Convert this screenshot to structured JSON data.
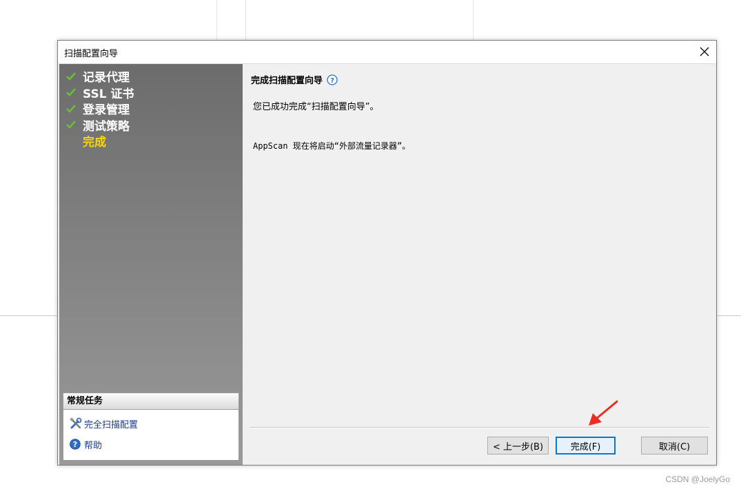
{
  "dialog": {
    "title": "扫描配置向导",
    "close_icon": "close-icon"
  },
  "steps": [
    {
      "label": "记录代理",
      "done": true
    },
    {
      "label": "SSL 证书",
      "done": true
    },
    {
      "label": "登录管理",
      "done": true
    },
    {
      "label": "测试策略",
      "done": true
    },
    {
      "label": "完成",
      "done": false,
      "current": true
    }
  ],
  "tasks": {
    "header": "常规任务",
    "items": [
      {
        "label": "完全扫描配置",
        "icon": "tools-icon"
      },
      {
        "label": "帮助",
        "icon": "help-icon"
      }
    ]
  },
  "main": {
    "heading": "完成扫描配置向导",
    "message_1": "您已成功完成“扫描配置向导”。",
    "message_2": "AppScan 现在将启动“外部流量记录器”。"
  },
  "buttons": {
    "back": "< 上一步(B)",
    "finish": "完成(F)",
    "cancel": "取消(C)"
  },
  "watermark": "CSDN @JoelyGo",
  "colors": {
    "current_step": "#ffd700",
    "check": "#6abf3a",
    "link": "#1a3a8c",
    "annotation_arrow": "#ee2b1f"
  }
}
